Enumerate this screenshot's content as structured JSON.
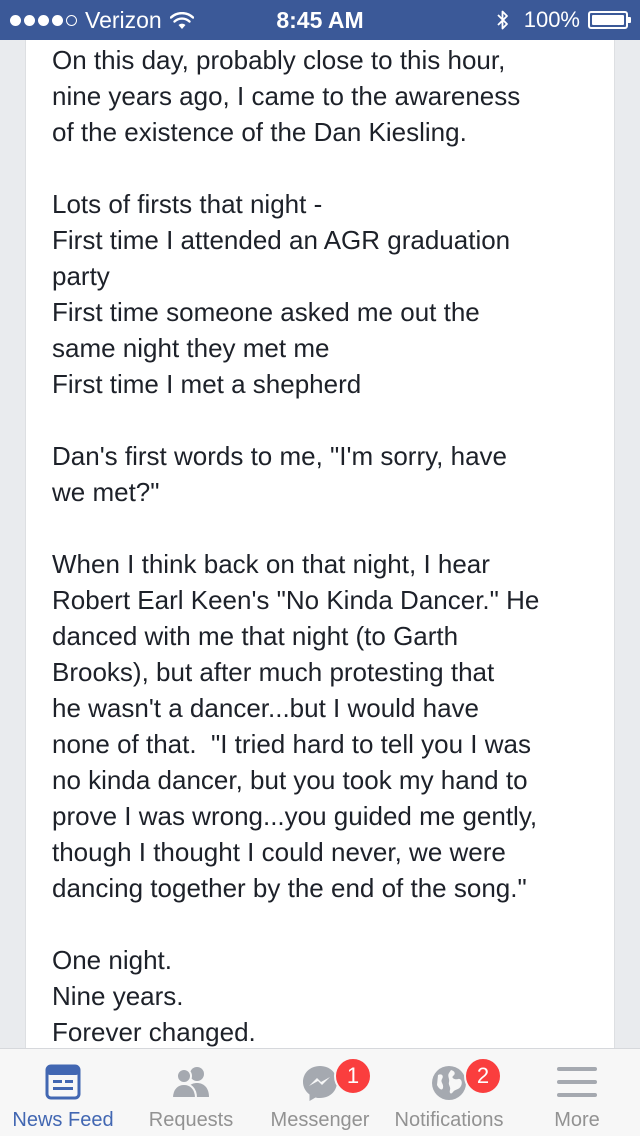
{
  "status_bar": {
    "carrier": "Verizon",
    "time": "8:45 AM",
    "battery": "100%",
    "signal_bars_filled": 4,
    "signal_bars_total": 5,
    "battery_level": 1.0
  },
  "post": {
    "lines": [
      "On this day, probably close to this hour,",
      "nine years ago, I came to the awareness",
      "of the existence of the Dan Kiesling.",
      "",
      "Lots of firsts that night -",
      "First time I attended an AGR graduation",
      "party",
      "First time someone asked me out the",
      "same night they met me",
      "First time I met a shepherd",
      "",
      "Dan's first words to me, \"I'm sorry, have",
      "we met?\"",
      "",
      "When I think back on that night, I hear",
      "Robert Earl Keen's \"No Kinda Dancer.\" He",
      "danced with me that night (to Garth",
      "Brooks), but after much protesting that",
      "he wasn't a dancer...but I would have",
      "none of that.  \"I tried hard to tell you I was",
      "no kinda dancer, but you took my hand to",
      "prove I was wrong...you guided me gently,",
      "though I thought I could never, we were",
      "dancing together by the end of the song.\"",
      "",
      "One night.",
      "Nine years.",
      "Forever changed."
    ]
  },
  "tab_bar": {
    "news_feed": "News Feed",
    "requests": "Requests",
    "messenger": "Messenger",
    "messenger_badge": "1",
    "notifications": "Notifications",
    "notifications_badge": "2",
    "more": "More"
  },
  "colors": {
    "brand": "#3b5998",
    "active_tab": "#4267b2",
    "inactive_tab": "#929292",
    "badge": "#fa3e3e"
  },
  "icons": {
    "news_feed": "news-feed-icon",
    "requests": "friends-icon",
    "messenger": "messenger-icon",
    "notifications": "globe-icon",
    "more": "hamburger-menu-icon"
  }
}
